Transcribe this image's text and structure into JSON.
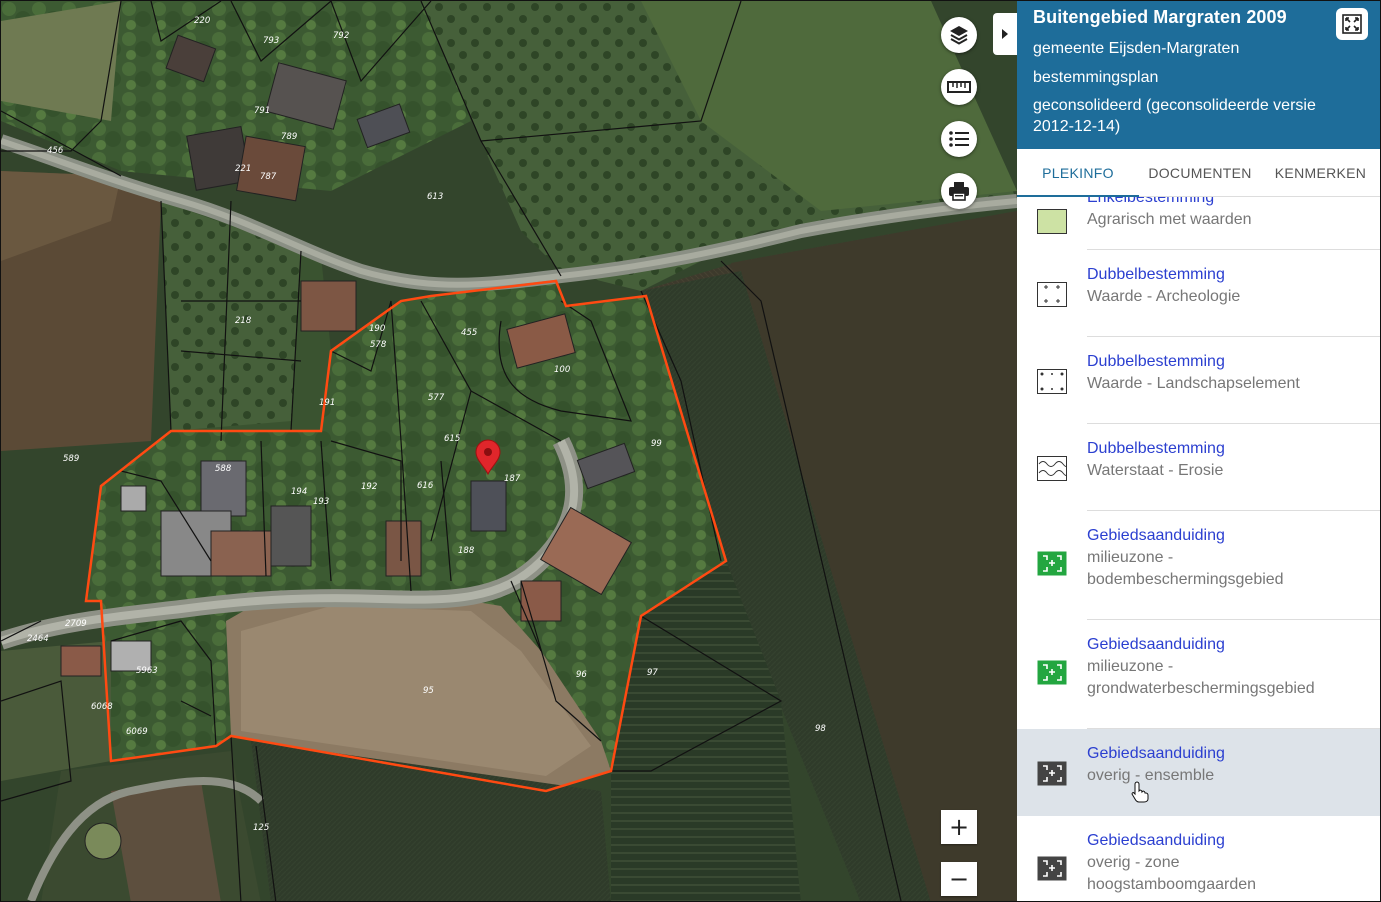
{
  "map": {
    "parcels": [
      "220",
      "793",
      "792",
      "791",
      "789",
      "221",
      "787",
      "456",
      "613",
      "218",
      "190",
      "578",
      "455",
      "100",
      "191",
      "577",
      "615",
      "187",
      "99",
      "589",
      "588",
      "194",
      "193",
      "192",
      "616",
      "188",
      "2709",
      "2464",
      "5963",
      "6068",
      "6069",
      "95",
      "96",
      "97",
      "98",
      "125"
    ],
    "marker": "location-pin-icon",
    "controls": {
      "layers": "layers-icon",
      "measure": "ruler-icon",
      "legend": "list-icon",
      "print": "print-icon",
      "collapse": "chevron-right-icon",
      "zoom_in": "+",
      "zoom_out": "−"
    }
  },
  "panel": {
    "title": "Buitengebied Margraten 2009",
    "municipality": "gemeente Eijsden-Margraten",
    "plan_type": "bestemmingsplan",
    "status": "geconsolideerd (geconsolideerde versie 2012-12-14)",
    "expand_icon": "fullscreen-icon",
    "tabs": [
      {
        "label": "PLEKINFO",
        "active": true
      },
      {
        "label": "DOCUMENTEN",
        "active": false
      },
      {
        "label": "KENMERKEN",
        "active": false
      }
    ],
    "items": [
      {
        "title": "Enkelbestemming",
        "desc": "Agrarisch met waarden",
        "icon": "green-square-icon"
      },
      {
        "title": "Dubbelbestemming",
        "desc": "Waarde - Archeologie",
        "icon": "crosses-frame-icon"
      },
      {
        "title": "Dubbelbestemming",
        "desc": "Waarde - Landschapselement",
        "icon": "dotted-frame-icon"
      },
      {
        "title": "Dubbelbestemming",
        "desc": "Waterstaat - Erosie",
        "icon": "wave-frame-icon"
      },
      {
        "title": "Gebiedsaanduiding",
        "desc1": "milieuzone -",
        "desc2": "bodembeschermingsgebied",
        "icon": "green-zone-icon"
      },
      {
        "title": "Gebiedsaanduiding",
        "desc1": "milieuzone -",
        "desc2": "grondwaterbeschermingsgebied",
        "icon": "green-zone-icon"
      },
      {
        "title": "Gebiedsaanduiding",
        "desc": "overig - ensemble",
        "icon": "grey-zone-icon"
      },
      {
        "title": "Gebiedsaanduiding",
        "desc1": "overig - zone",
        "desc2": "hoogstamboomgaarden",
        "icon": "grey-zone-icon"
      }
    ]
  },
  "colors": {
    "header_bg": "#1e6d9a",
    "link": "#2b3fd0",
    "plan_outline": "#ff4a12",
    "marker": "#e0262b",
    "hover_row": "#dde3e9"
  }
}
